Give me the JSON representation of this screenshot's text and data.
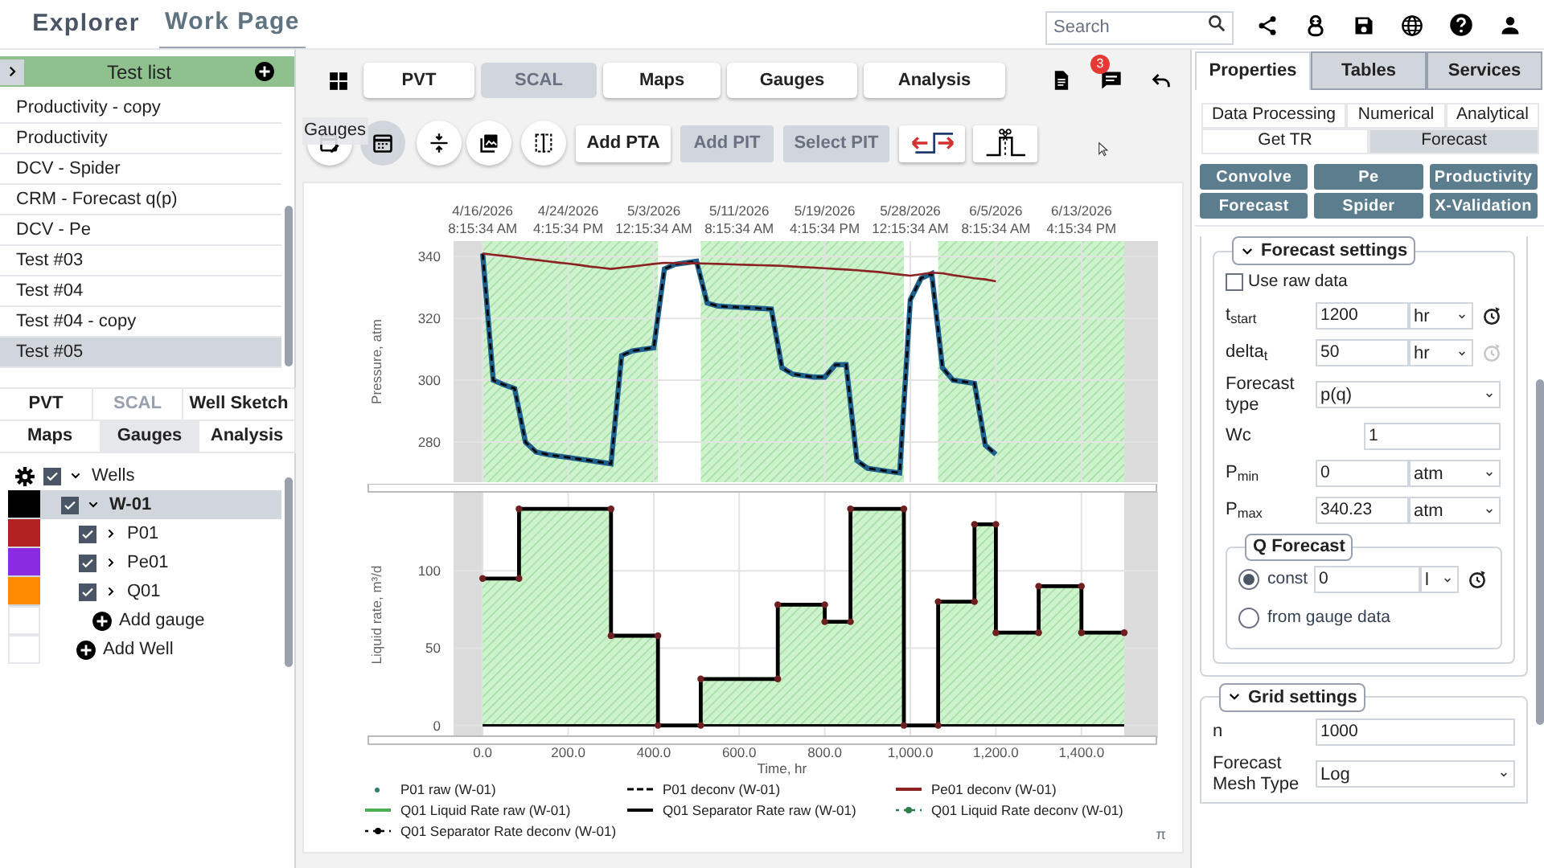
{
  "top_bar": {
    "tabs": [
      {
        "label": "Explorer",
        "selected": false
      },
      {
        "label": "Work Page",
        "selected": true
      }
    ],
    "search": {
      "placeholder": "Search"
    }
  },
  "test_list": {
    "title": "Test list",
    "items": [
      {
        "label": "Productivity - copy",
        "selected": false
      },
      {
        "label": "Productivity",
        "selected": false
      },
      {
        "label": "DCV - Spider",
        "selected": false
      },
      {
        "label": "CRM - Forecast q(p)",
        "selected": false
      },
      {
        "label": "DCV - Pe",
        "selected": false
      },
      {
        "label": "Test #03",
        "selected": false
      },
      {
        "label": "Test #04",
        "selected": false
      },
      {
        "label": "Test #04 - copy",
        "selected": false
      },
      {
        "label": "Test #05",
        "selected": true
      }
    ]
  },
  "module_tabs": [
    {
      "label": "PVT",
      "selected": false,
      "disabled": false
    },
    {
      "label": "SCAL",
      "selected": false,
      "disabled": true
    },
    {
      "label": "Well Sketch",
      "selected": false,
      "disabled": false
    },
    {
      "label": "Maps",
      "selected": false,
      "disabled": false
    },
    {
      "label": "Gauges",
      "selected": true,
      "disabled": false
    },
    {
      "label": "Analysis",
      "selected": false,
      "disabled": false
    }
  ],
  "tree": [
    {
      "label": "Wells",
      "checked": true,
      "expanded": true,
      "selected": false,
      "add_label": "Add Well",
      "children": [
        {
          "label": "W-01",
          "checked": true,
          "expanded": true,
          "selected": true,
          "color": "#000000",
          "add_label": "Add gauge",
          "children": [
            {
              "label": "P01",
              "checked": true,
              "expanded": false,
              "selected": false,
              "color": "#b22222"
            },
            {
              "label": "Pe01",
              "checked": true,
              "expanded": false,
              "selected": false,
              "color": "#8a2be2"
            },
            {
              "label": "Q01",
              "checked": true,
              "expanded": false,
              "selected": false,
              "color": "#ff8c00"
            }
          ]
        }
      ]
    }
  ],
  "main": {
    "module_buttons": [
      {
        "label": "PVT",
        "disabled": false
      },
      {
        "label": "SCAL",
        "disabled": true
      },
      {
        "label": "Maps",
        "disabled": false
      },
      {
        "label": "Gauges",
        "disabled": false
      },
      {
        "label": "Analysis",
        "disabled": false
      }
    ],
    "notification_count": "3",
    "tooltip": "Gauges",
    "tool_icons": [
      {
        "kind": "edit-calendar",
        "selected": false
      },
      {
        "kind": "calendar",
        "selected": true
      },
      {
        "kind": "compress",
        "selected": false
      },
      {
        "kind": "images",
        "selected": false
      },
      {
        "kind": "split",
        "selected": false
      }
    ],
    "actions": [
      {
        "label": "Add PTA",
        "disabled": false
      },
      {
        "label": "Add PIT",
        "disabled": true
      },
      {
        "label": "Select PIT",
        "disabled": true
      }
    ],
    "pressure_chart": {
      "chart_data": {
        "type": "line",
        "ylabel": "Pressure, atm",
        "grid": true,
        "categories": [
          "4/16/2026 8:15:34 AM",
          null,
          null,
          null,
          null,
          null,
          null,
          null,
          "4/24/2026 4:15:34 PM",
          null,
          null,
          null,
          null,
          null,
          null,
          null,
          "5/3/2026 12:15:34 AM",
          null,
          null,
          null,
          null,
          null,
          null,
          null,
          "5/11/2026 8:15:34 AM",
          null,
          null,
          null,
          null,
          null,
          null,
          null,
          "5/19/2026 4:15:34 PM",
          null,
          null,
          null,
          null,
          null,
          null,
          null,
          "5/28/2026 12:15:34 AM",
          null,
          null,
          null,
          null,
          null,
          null,
          null,
          "6/5/2026 8:15:34 AM",
          null,
          null,
          null,
          null,
          null,
          null,
          null,
          "6/13/2026 4:15:34 PM"
        ],
        "series": [
          {
            "color": "#1f5f8b",
            "values": [
              341,
              300,
              298.5,
              297.3,
              280,
              276.8,
              276,
              275.5,
              275,
              274.5,
              274,
              273.5,
              273,
              308,
              309.5,
              310,
              310.5,
              336,
              337.5,
              338,
              338.5,
              325,
              324,
              323.8,
              323.6,
              323.4,
              323.2,
              323,
              304,
              302,
              301.5,
              301,
              301,
              305,
              305,
              274,
              271.5,
              271,
              270.5,
              270,
              326,
              333,
              334.5,
              304,
              300,
              299.5,
              299,
              279,
              276,
              null,
              null,
              null,
              null,
              null,
              null,
              null,
              null
            ]
          },
          {
            "color": "#8b2323",
            "values": [
              341,
              340.6,
              340.2,
              339.8,
              339.3,
              338.9,
              338.5,
              338.1,
              337.7,
              337.3,
              336.8,
              336.4,
              336,
              336.4,
              336.8,
              337.2,
              337.6,
              338,
              337.9,
              337.9,
              337.8,
              337.7,
              337.6,
              337.5,
              337.4,
              337.3,
              337.2,
              337.1,
              337,
              336.8,
              336.6,
              336.4,
              336.2,
              336,
              335.8,
              335.6,
              335.3,
              335,
              334.6,
              334.2,
              333.8,
              334.3,
              334.8,
              334.6,
              334,
              333.5,
              333,
              332.6,
              332,
              null,
              null,
              null,
              null,
              null,
              null,
              null,
              null
            ]
          }
        ],
        "ylim": [
          267,
          345
        ],
        "yticks": [
          280,
          300,
          320,
          340
        ]
      }
    },
    "rate_chart": {
      "chart_data": {
        "type": "area",
        "xlabel": "Time, hr",
        "ylabel": "Liquid rate, m³/d",
        "grid": true,
        "x": [
          0,
          85,
          85,
          300,
          300,
          410,
          410,
          510,
          510,
          690,
          690,
          800,
          800,
          860,
          860,
          985,
          985,
          1065,
          1065,
          1150,
          1150,
          1200,
          1200,
          1300,
          1300,
          1400,
          1400,
          1500
        ],
        "series": [
          {
            "color": "#000000",
            "marker": "circle",
            "values": [
              95,
              95,
              140,
              140,
              58,
              58,
              0,
              0,
              30,
              30,
              78,
              78,
              67,
              67,
              140,
              140,
              0,
              0,
              80,
              80,
              130,
              130,
              60,
              60,
              90,
              90,
              60,
              60
            ]
          }
        ],
        "xlim": [
          -68,
          1579
        ],
        "ylim": [
          -8,
          151
        ],
        "xticks": [
          {
            "value": 0,
            "label": "0.0"
          },
          {
            "value": 200,
            "label": "200.0"
          },
          {
            "value": 400,
            "label": "400.0"
          },
          {
            "value": 600,
            "label": "600.0"
          },
          {
            "value": 800,
            "label": "800.0"
          },
          {
            "value": 1000,
            "label": "1,000.0"
          },
          {
            "value": 1200,
            "label": "1,200.0"
          },
          {
            "value": 1400,
            "label": "1,400.0"
          }
        ],
        "yticks": [
          0,
          50,
          100
        ]
      }
    },
    "legend": [
      {
        "kind": "dot",
        "label": "P01 raw (W-01)",
        "color": "#2e7d6e"
      },
      {
        "kind": "dashed",
        "label": "P01 deconv (W-01)",
        "color": "#000000"
      },
      {
        "kind": "line",
        "label": "Pe01 deconv (W-01)",
        "color": "#8b2323"
      },
      {
        "kind": "line",
        "label": "Q01 Liquid Rate raw (W-01)",
        "color": "#4caf50"
      },
      {
        "kind": "line",
        "label": "Q01 Separator Rate raw (W-01)",
        "color": "#000000"
      },
      {
        "kind": "dot-dash",
        "label": "Q01 Liquid Rate deconv (W-01)",
        "color": "#2e7d4e"
      },
      {
        "kind": "dot-dash",
        "label": "Q01 Separator Rate deconv (W-01)",
        "color": "#000000"
      }
    ],
    "footnote": "π"
  },
  "right_panel": {
    "tabs": [
      {
        "label": "Properties",
        "selected": true
      },
      {
        "label": "Tables",
        "selected": false
      },
      {
        "label": "Services",
        "selected": false
      }
    ],
    "sub_tabs": [
      {
        "label": "Data Processing",
        "selected": false
      },
      {
        "label": "Numerical",
        "selected": false
      },
      {
        "label": "Analytical",
        "selected": false
      },
      {
        "label": "Get TR",
        "selected": false
      },
      {
        "label": "Forecast",
        "selected": true
      }
    ],
    "buttons": [
      "Convolve",
      "Pe",
      "Productivity",
      "Forecast",
      "Spider",
      "X-Validation"
    ],
    "forecast_settings": {
      "title": "Forecast settings",
      "use_raw_data": {
        "label": "Use raw data",
        "checked": false
      },
      "fields": [
        {
          "kind": "unit",
          "label": "t$_{start}$",
          "value": "1200",
          "unit": "hr",
          "reset_disabled": false
        },
        {
          "kind": "unit",
          "label": "delta$_{t}$",
          "value": "50",
          "unit": "hr",
          "reset_disabled": true
        },
        {
          "kind": "select",
          "label": "Forecast type",
          "value": "p(q)"
        },
        {
          "kind": "input",
          "label": "Wc",
          "value": "1"
        },
        {
          "kind": "unit",
          "label": "P$_{min}$",
          "value": "0",
          "unit": "atm"
        },
        {
          "kind": "unit",
          "label": "P$_{max}$",
          "value": "340.23",
          "unit": "atm"
        }
      ],
      "q_forecast": {
        "title": "Q Forecast",
        "options": [
          {
            "label": "const",
            "selected": true,
            "value": "0",
            "unit": "l",
            "reset_disabled": false
          },
          {
            "label": "from gauge data",
            "selected": false
          }
        ]
      }
    },
    "grid_settings": {
      "title": "Grid settings",
      "fields": [
        {
          "kind": "input",
          "label": "n",
          "value": "1000"
        },
        {
          "kind": "select",
          "label": "Forecast Mesh Type",
          "value": "Log"
        }
      ]
    }
  }
}
